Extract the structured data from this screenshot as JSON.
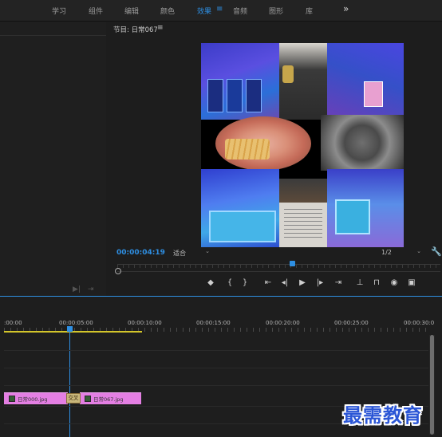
{
  "workspaces": [
    "学习",
    "组件",
    "编辑",
    "颜色",
    "效果",
    "音频",
    "图形",
    "库"
  ],
  "active_workspace": "效果",
  "program_monitor": {
    "title": "节目: 日常067",
    "timecode": "00:00:04:19",
    "fit": "适合",
    "resolution": "1/2"
  },
  "playback_controls": [
    "marker-icon",
    "in-point-icon",
    "out-point-icon",
    "go-to-in-icon",
    "step-back-icon",
    "play-icon",
    "step-forward-icon",
    "go-to-out-icon",
    "lift-icon",
    "extract-icon",
    "export-frame-icon",
    "comparison-view-icon"
  ],
  "timeline": {
    "ticks": [
      ":00:00",
      "00:00:05:00",
      "00:00:10:00",
      "00:00:15:00",
      "00:00:20:00",
      "00:00:25:00",
      "00:00:30:0"
    ],
    "clips": [
      "日常000.jpg",
      "日常067.jpg"
    ],
    "transition_label": "交叉"
  },
  "watermark": "最需教育",
  "colors": {
    "accent": "#2e8fe3",
    "clip": "#e47fe3",
    "work_area": "#d3c52a"
  }
}
